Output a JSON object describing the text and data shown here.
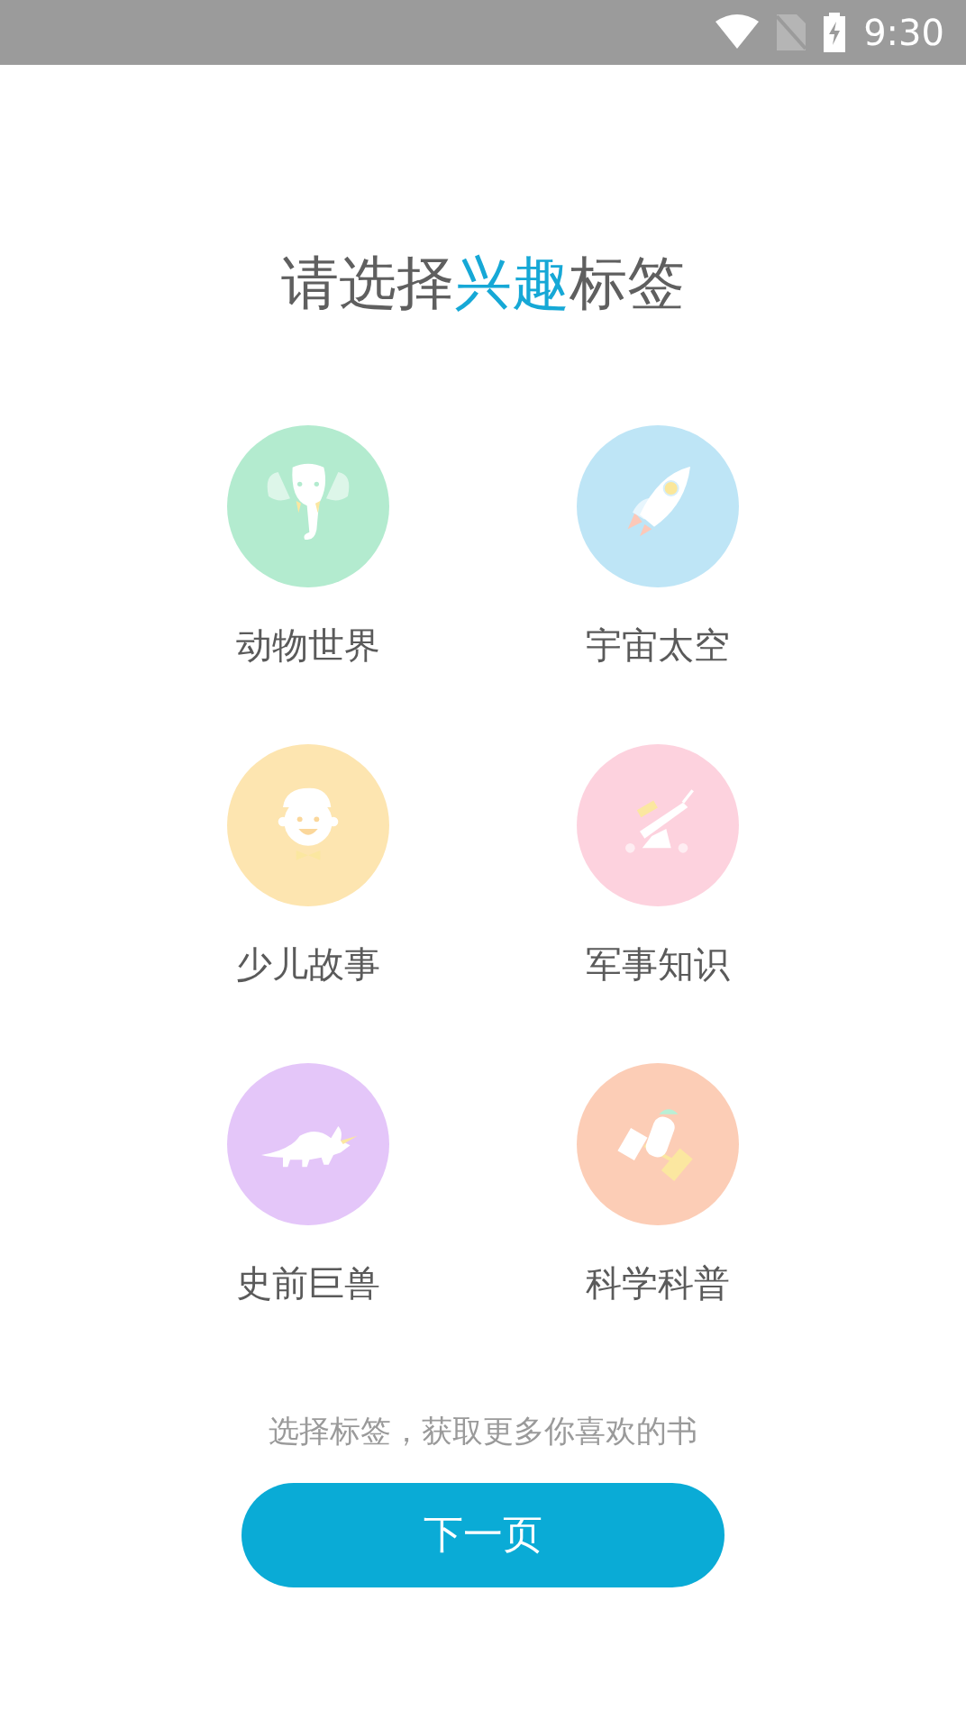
{
  "status_bar": {
    "time": "9:30"
  },
  "title": [
    {
      "text": "请选择",
      "highlighted": false
    },
    {
      "text": "兴趣",
      "highlighted": true
    },
    {
      "text": "标签",
      "highlighted": false
    }
  ],
  "tags": [
    {
      "label": "动物世界",
      "kind": "elephant",
      "color": "#b3ebcf"
    },
    {
      "label": "宇宙太空",
      "kind": "rocket",
      "color": "#bee5f6"
    },
    {
      "label": "少儿故事",
      "kind": "boy",
      "color": "#fde5b0"
    },
    {
      "label": "军事知识",
      "kind": "cannon",
      "color": "#fdd2de"
    },
    {
      "label": "史前巨兽",
      "kind": "dinosaur",
      "color": "#e4c6f9"
    },
    {
      "label": "科学科普",
      "kind": "satellite",
      "color": "#fccdb6"
    }
  ],
  "hint": "选择标签，获取更多你喜欢的书",
  "next_button": "下一页"
}
